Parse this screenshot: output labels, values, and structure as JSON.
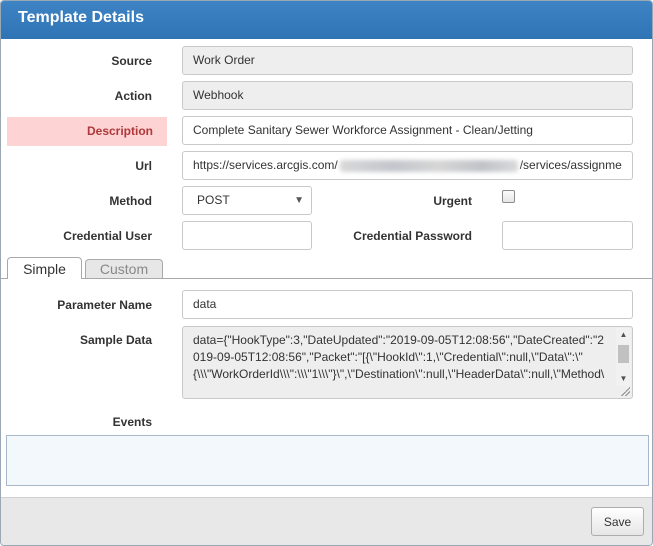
{
  "dialog": {
    "title": "Template Details",
    "title_color": "#3a80c0"
  },
  "form": {
    "source": {
      "label": "Source",
      "value": "Work Order"
    },
    "action": {
      "label": "Action",
      "value": "Webhook"
    },
    "description": {
      "label": "Description",
      "value": "Complete Sanitary Sewer Workforce Assignment - Clean/Jetting",
      "highlight_color": "#fdd3d3"
    },
    "url": {
      "label": "Url",
      "value_start": "https://services.arcgis.com/",
      "value_end": "/services/assignme"
    },
    "method": {
      "label": "Method",
      "selected": "POST"
    },
    "urgent": {
      "label": "Urgent",
      "checked": false
    },
    "credential_user": {
      "label": "Credential User",
      "value": ""
    },
    "credential_password": {
      "label": "Credential Password",
      "value": ""
    }
  },
  "tabs": [
    {
      "label": "Simple",
      "active": true
    },
    {
      "label": "Custom",
      "active": false
    }
  ],
  "simple": {
    "parameter_name": {
      "label": "Parameter Name",
      "value": "data"
    },
    "sample_data": {
      "label": "Sample Data",
      "value": "data={\"HookType\":3,\"DateUpdated\":\"2019-09-05T12:08:56\",\"DateCreated\":\"2019-09-05T12:08:56\",\"Packet\":\"[{\\\"HookId\\\":1,\\\"Credential\\\":null,\\\"Data\\\":\\\"{\\\\\\\"WorkOrderId\\\\\\\":\\\\\\\"1\\\\\\\"}\\\",\\\"Destination\\\":null,\\\"HeaderData\\\":null,\\\"Method\\"
    },
    "events": {
      "label": "Events"
    }
  },
  "footer": {
    "save_label": "Save"
  }
}
